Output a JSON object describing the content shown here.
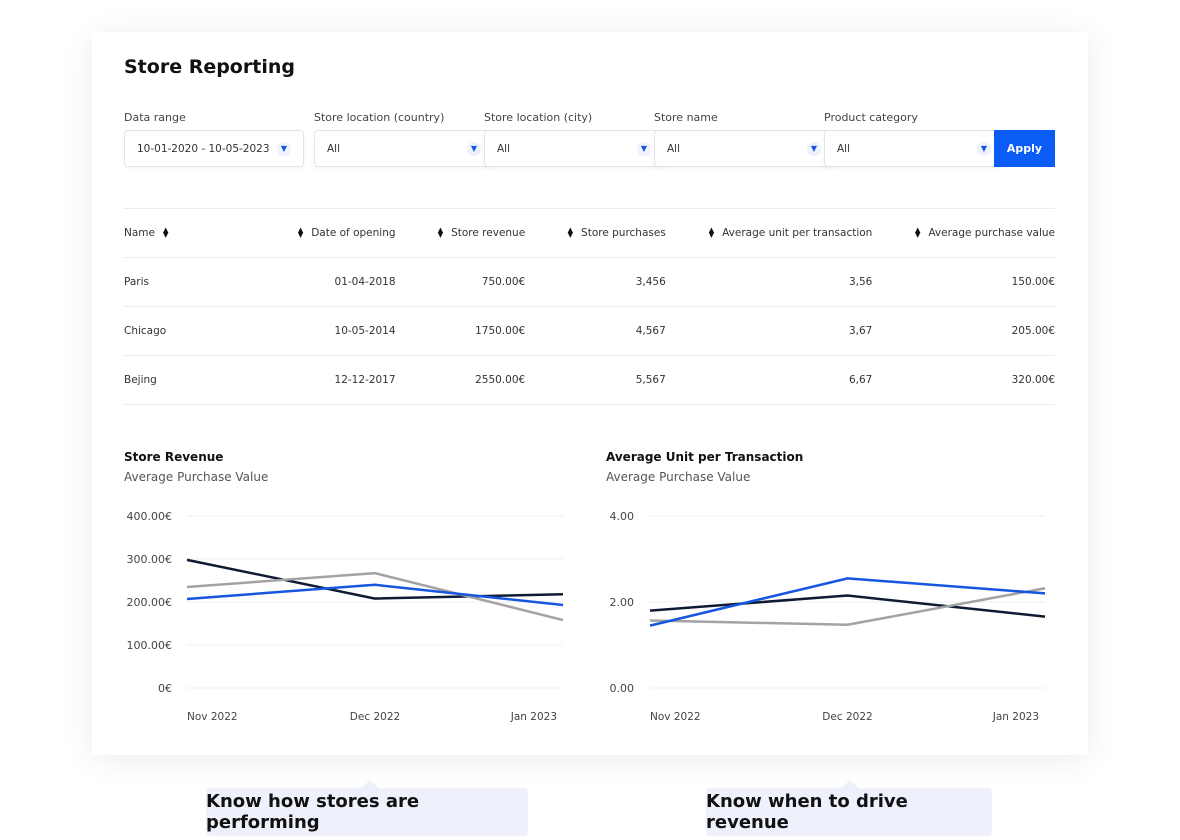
{
  "header": {
    "title": "Store Reporting"
  },
  "filters": [
    {
      "label": "Data range",
      "value": "10-01-2020 - 10-05-2023"
    },
    {
      "label": "Store location (country)",
      "value": "All"
    },
    {
      "label": "Store location (city)",
      "value": "All"
    },
    {
      "label": "Store name",
      "value": "All"
    },
    {
      "label": "Product category",
      "value": "All"
    }
  ],
  "apply_label": "Apply",
  "accent": "#0a5cf5",
  "table": {
    "columns": [
      "Name",
      "Date of opening",
      "Store revenue",
      "Store purchases",
      "Average unit per transaction",
      "Average purchase value"
    ],
    "rows": [
      [
        "Paris",
        "01-04-2018",
        "750.00€",
        "3,456",
        "3,56",
        "150.00€"
      ],
      [
        "Chicago",
        "10-05-2014",
        "1750.00€",
        "4,567",
        "3,67",
        "205.00€"
      ],
      [
        "Bejing",
        "12-12-2017",
        "2550.00€",
        "5,567",
        "6,67",
        "320.00€"
      ]
    ]
  },
  "chart_data": [
    {
      "type": "line",
      "title": "Store Revenue",
      "subtitle": "Average Purchase Value",
      "categories": [
        "Nov 2022",
        "Dec 2022",
        "Jan 2023"
      ],
      "yticks": [
        "0€",
        "100.00€",
        "200.00€",
        "300.00€",
        "400.00€"
      ],
      "ylim": [
        0,
        400
      ],
      "grid": true,
      "series": [
        {
          "color": "#0f1b33",
          "values": [
            298,
            208,
            218
          ]
        },
        {
          "color": "#a3a3a3",
          "values": [
            235,
            267,
            158
          ]
        },
        {
          "color": "#1656e0",
          "values": [
            207,
            240,
            193
          ]
        }
      ]
    },
    {
      "type": "line",
      "title": "Average Unit per Transaction",
      "subtitle": "Average Purchase Value",
      "categories": [
        "Nov 2022",
        "Dec 2022",
        "Jan 2023"
      ],
      "yticks": [
        "0.00",
        "2.00",
        "4.00"
      ],
      "ylim": [
        0,
        4
      ],
      "grid": true,
      "series": [
        {
          "color": "#0f1b33",
          "values": [
            1.8,
            2.15,
            1.66
          ]
        },
        {
          "color": "#a3a3a3",
          "values": [
            1.57,
            1.47,
            2.32
          ]
        },
        {
          "color": "#1656e0",
          "values": [
            1.45,
            2.55,
            2.2
          ]
        }
      ]
    }
  ],
  "callouts": [
    "Know how stores are performing",
    "Know when to drive revenue"
  ]
}
